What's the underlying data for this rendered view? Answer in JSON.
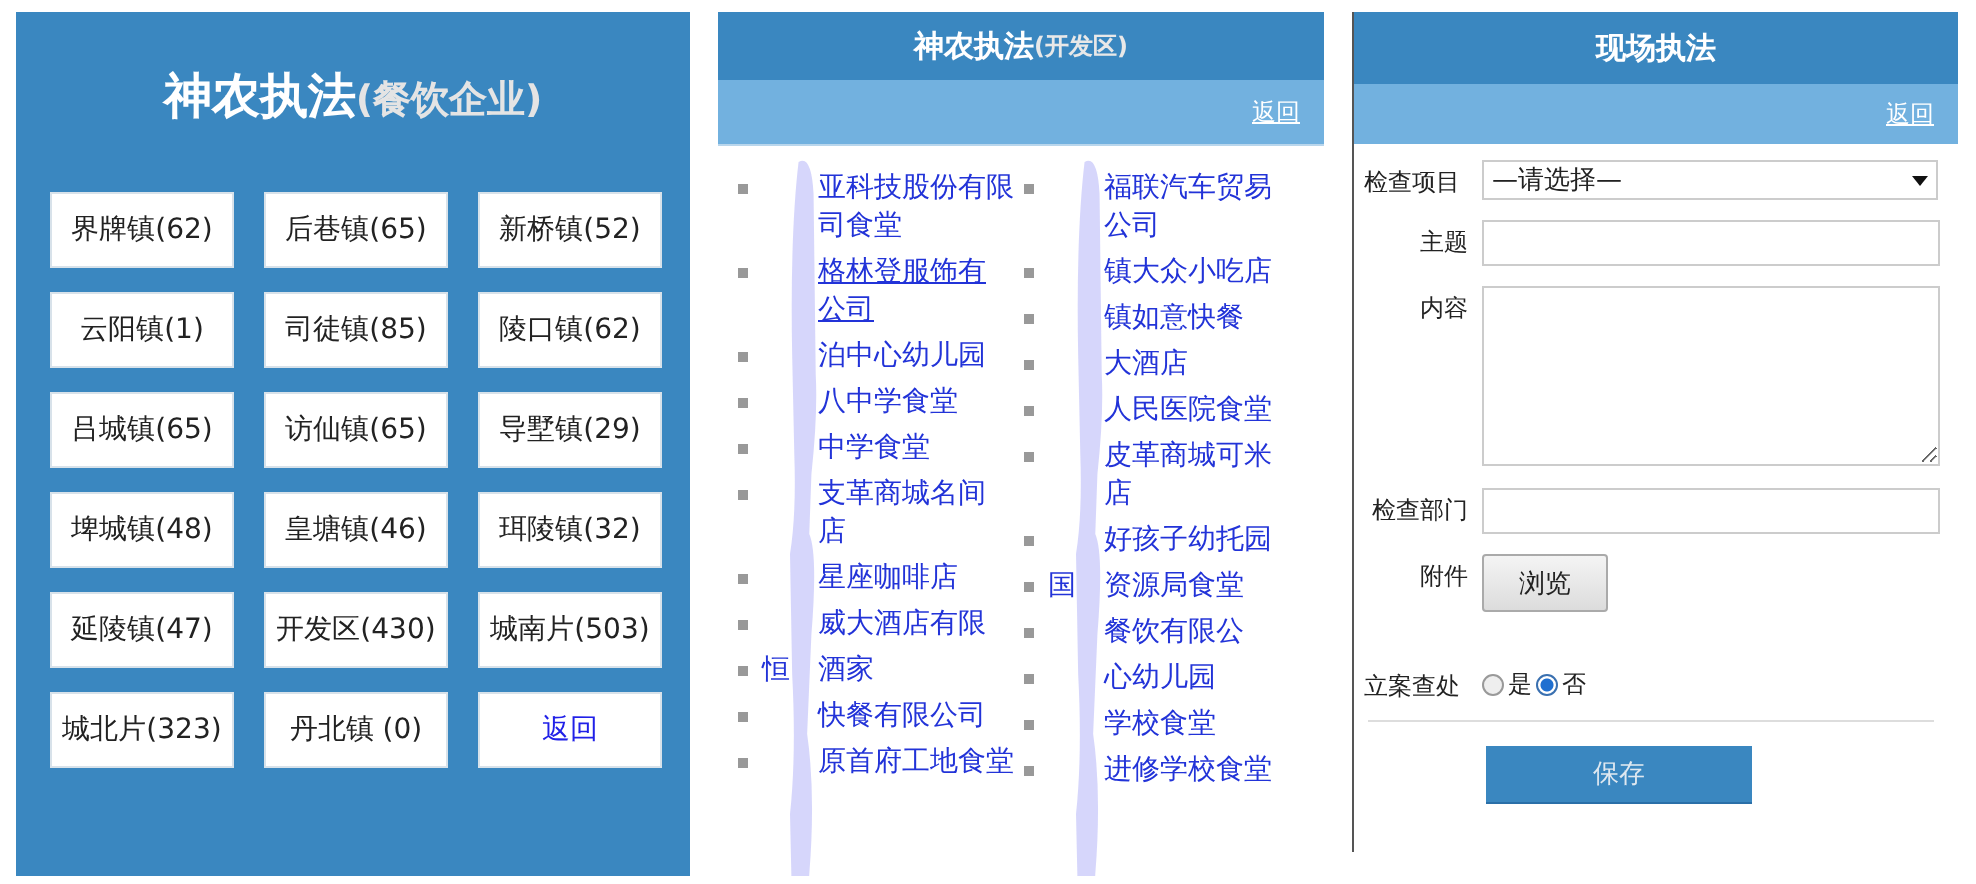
{
  "town_panel": {
    "title": "神农执法",
    "subtitle": "(餐饮企业)",
    "buttons": [
      {
        "label": "界牌镇(62)",
        "kind": "town"
      },
      {
        "label": "后巷镇(65)",
        "kind": "town"
      },
      {
        "label": "新桥镇(52)",
        "kind": "town"
      },
      {
        "label": "云阳镇(1)",
        "kind": "town"
      },
      {
        "label": "司徒镇(85)",
        "kind": "town"
      },
      {
        "label": "陵口镇(62)",
        "kind": "town"
      },
      {
        "label": "吕城镇(65)",
        "kind": "town"
      },
      {
        "label": "访仙镇(65)",
        "kind": "town"
      },
      {
        "label": "导墅镇(29)",
        "kind": "town"
      },
      {
        "label": "埤城镇(48)",
        "kind": "town"
      },
      {
        "label": "皇塘镇(46)",
        "kind": "town"
      },
      {
        "label": "珥陵镇(32)",
        "kind": "town"
      },
      {
        "label": "延陵镇(47)",
        "kind": "town"
      },
      {
        "label": "开发区(430)",
        "kind": "town"
      },
      {
        "label": "城南片(503)",
        "kind": "town"
      },
      {
        "label": "城北片(323)",
        "kind": "town"
      },
      {
        "label": "丹北镇 (0)",
        "kind": "town"
      },
      {
        "label": "返回",
        "kind": "back"
      }
    ]
  },
  "list_panel": {
    "title": "神农执法",
    "subtitle": "(开发区)",
    "back_link": "返回",
    "columns": [
      {
        "items": [
          {
            "lines": [
              "亚科技股份有限",
              "司食堂"
            ],
            "hovered": false
          },
          {
            "lines": [
              "格林登服饰有",
              "公司"
            ],
            "hovered": true
          },
          {
            "lines": [
              "泊中心幼儿园"
            ],
            "hovered": false
          },
          {
            "lines": [
              "八中学食堂"
            ],
            "hovered": false
          },
          {
            "lines": [
              "中学食堂"
            ],
            "hovered": false
          },
          {
            "lines": [
              "支革商城名间",
              "店"
            ],
            "hovered": false
          },
          {
            "lines": [
              "星座咖啡店"
            ],
            "hovered": false
          },
          {
            "lines": [
              "威大酒店有限"
            ],
            "hovered": false
          },
          {
            "lead": "恒",
            "lines": [
              "酒家"
            ],
            "hovered": false
          },
          {
            "lines": [
              "快餐有限公司"
            ],
            "hovered": false
          },
          {
            "lines": [
              "原首府工地食堂"
            ],
            "hovered": false
          }
        ]
      },
      {
        "items": [
          {
            "lines": [
              "福联汽车贸易",
              "公司"
            ],
            "hovered": false
          },
          {
            "lines": [
              "镇大众小吃店"
            ],
            "hovered": false
          },
          {
            "lines": [
              "镇如意快餐"
            ],
            "hovered": false
          },
          {
            "lines": [
              "大酒店"
            ],
            "hovered": false
          },
          {
            "lines": [
              "人民医院食堂"
            ],
            "hovered": false
          },
          {
            "lines": [
              "皮革商城可米",
              "店"
            ],
            "hovered": false
          },
          {
            "lines": [
              "好孩子幼托园"
            ],
            "hovered": false
          },
          {
            "lead": "国",
            "lines": [
              "资源局食堂"
            ],
            "hovered": false
          },
          {
            "lines": [
              "餐饮有限公"
            ],
            "hovered": false
          },
          {
            "lines": [
              "心幼儿园"
            ],
            "hovered": false
          },
          {
            "lines": [
              "学校食堂"
            ],
            "hovered": false
          },
          {
            "lines": [
              "进修学校食堂"
            ],
            "hovered": false
          }
        ]
      }
    ]
  },
  "form_panel": {
    "title": "现场执法",
    "back_link": "返回",
    "fields": [
      {
        "kind": "select",
        "label": "检查项目",
        "value": "—请选择—"
      },
      {
        "kind": "text",
        "label": "主题"
      },
      {
        "kind": "textarea",
        "label": "内容"
      },
      {
        "kind": "text",
        "label": "检查部门"
      },
      {
        "kind": "file",
        "label": "附件",
        "button": "浏览"
      },
      {
        "kind": "radio",
        "label": "立案查处",
        "options": [
          {
            "label": "是",
            "selected": false
          },
          {
            "label": "否",
            "selected": true
          }
        ]
      }
    ],
    "save_button": "保存"
  }
}
